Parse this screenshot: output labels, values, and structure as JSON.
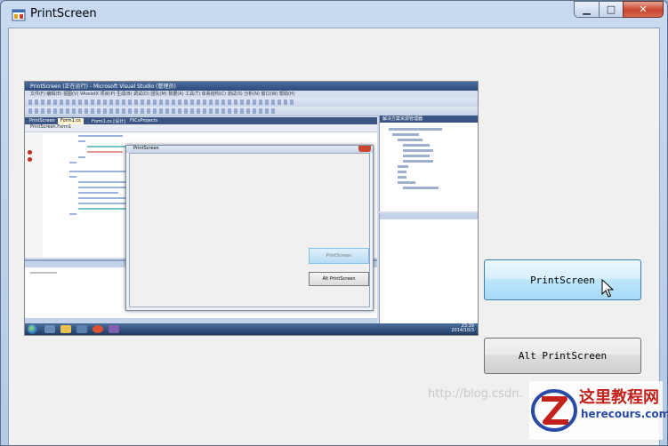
{
  "window": {
    "title": "PrintScreen"
  },
  "caption_buttons": {
    "minimize": "▁",
    "maximize": "□",
    "close": "✕"
  },
  "preview": {
    "vs_title": "PrintScreen (正在运行) - Microsoft Visual Studio (管理员)",
    "vs_menu": "文件(F)  编辑(E)  视图(V)  VAssistX  项目(P)  生成(B)  调试(D)  团队(M)  数据(A)  工具(T)  体系结构(C)  测试(S)  分析(N)  窗口(W)  帮助(H)",
    "vs_tabs": [
      "PrintScreen",
      "Form1.cs",
      "Form1.cs [设计]",
      "FilCsProjects"
    ],
    "vs_nav": "PrintScreen.Form1",
    "solution_header": "解决方案资源管理器",
    "inner_form_title": "PrintScreen",
    "inner_btn_print": "PrintScreen",
    "inner_btn_alt": "Alt PrintScreen",
    "clock_time": "23:39",
    "clock_date": "2014/10/3"
  },
  "buttons": {
    "print_label": "PrintScreen",
    "alt_label": "Alt PrintScreen"
  },
  "watermark": {
    "url": "http://blog.csdn.",
    "logo_cn": "这里教程网",
    "logo_en": "herecours.com"
  },
  "colors": {
    "accent_button": "#bee6fd",
    "logo_red": "#c2211b",
    "logo_blue": "#2a4aa8"
  }
}
